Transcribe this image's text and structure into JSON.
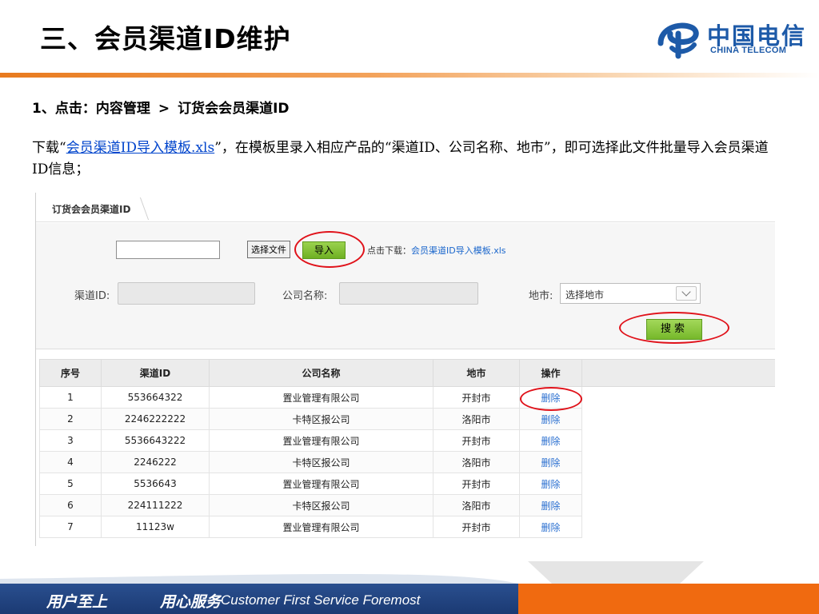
{
  "slide": {
    "title": "三、会员渠道ID维护",
    "step": "1、点击：内容管理",
    "step_arrow": ">",
    "step_target": "订货会会员渠道ID",
    "desc_prefix": "下载“",
    "desc_link": "会员渠道ID导入模板.xls",
    "desc_suffix": "”，在模板里录入相应产品的“渠道ID、公司名称、地市”，即可选择此文件批量导入会员渠道ID信息；"
  },
  "logo": {
    "cn": "中国电信",
    "en": "CHINA TELECOM",
    "icon": "china-telecom-logo",
    "color": "#1d5aa8"
  },
  "app": {
    "tab_label": "订货会会员渠道ID",
    "file_input_value": "",
    "choose_file_label": "选择文件",
    "import_label": "导入",
    "download_prefix": "点击下载：",
    "download_link": "会员渠道ID导入模板.xls",
    "filters": {
      "channel_label": "渠道ID:",
      "channel_value": "",
      "company_label": "公司名称:",
      "company_value": "",
      "city_label": "地市:",
      "city_selected": "选择地市"
    },
    "search_label": "搜索",
    "table": {
      "headers": [
        "序号",
        "渠道ID",
        "公司名称",
        "地市",
        "操作"
      ],
      "rows": [
        [
          "1",
          "553664322",
          "置业管理有限公司",
          "开封市",
          "删除"
        ],
        [
          "2",
          "2246222222",
          "卡特区报公司",
          "洛阳市",
          "删除"
        ],
        [
          "3",
          "5536643222",
          "置业管理有限公司",
          "开封市",
          "删除"
        ],
        [
          "4",
          "2246222",
          "卡特区报公司",
          "洛阳市",
          "删除"
        ],
        [
          "5",
          "5536643",
          "置业管理有限公司",
          "开封市",
          "删除"
        ],
        [
          "6",
          "224111222",
          "卡特区报公司",
          "洛阳市",
          "删除"
        ],
        [
          "7",
          "11123w",
          "置业管理有限公司",
          "开封市",
          "删除"
        ]
      ]
    }
  },
  "footer": {
    "slogan_1": "用户至上",
    "slogan_2": "用心服务",
    "slogan_en": "Customer First Service Foremost",
    "colors": {
      "blue": "#1b3a73",
      "orange": "#f06a10"
    }
  },
  "colors": {
    "accent_orange": "#e87a1e",
    "button_green": "#76b82a",
    "highlight_red": "#e0121a",
    "link_blue": "#2a6fd0"
  }
}
